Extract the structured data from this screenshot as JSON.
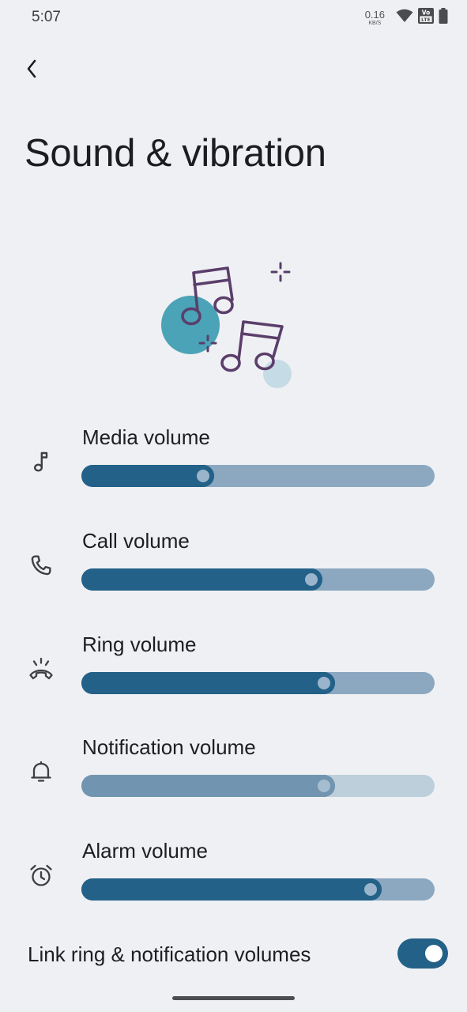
{
  "status_bar": {
    "time": "5:07",
    "net_speed": "0.16",
    "net_unit": "KB/S",
    "icons": [
      "wifi-icon",
      "volte-icon",
      "battery-icon"
    ]
  },
  "page": {
    "title": "Sound & vibration",
    "back_icon": "chevron-left-icon"
  },
  "volumes": [
    {
      "label": "Media volume",
      "icon": "music-note-icon",
      "level": 0.335,
      "enabled": true
    },
    {
      "label": "Call volume",
      "icon": "phone-icon",
      "level": 0.66,
      "enabled": true
    },
    {
      "label": "Ring volume",
      "icon": "ring-icon",
      "level": 0.7,
      "enabled": true
    },
    {
      "label": "Notification volume",
      "icon": "bell-icon",
      "level": 0.7,
      "enabled": false
    },
    {
      "label": "Alarm volume",
      "icon": "alarm-clock-icon",
      "level": 0.84,
      "enabled": true
    }
  ],
  "link_toggle": {
    "label": "Link ring & notification volumes",
    "enabled": true
  },
  "colors": {
    "accent": "#236188",
    "track": "#8ba8c0",
    "background": "#eff0f3",
    "illustration_teal": "#4ba3b7",
    "illustration_purple": "#5b3e6b"
  }
}
